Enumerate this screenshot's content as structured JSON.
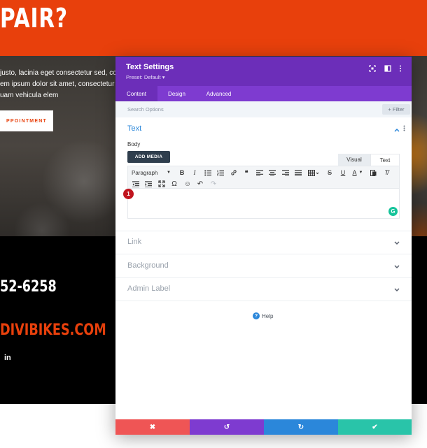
{
  "background_page": {
    "hero_title": "PAIR?",
    "hero_text_lines": [
      "justo, lacinia eget consectetur sed, conv",
      "em ipsum dolor sit amet, consectetur ad",
      "uam vehicula elem"
    ],
    "hero_button_label": "PPOINTMENT",
    "phone": "52-6258",
    "email": "DIVIBIKES.COM",
    "social_label": "in",
    "colors": {
      "brand": "#e8400c",
      "dark": "#000000"
    }
  },
  "modal": {
    "title": "Text Settings",
    "preset": "Preset: Default ▾",
    "header_icons": [
      "expand-icon",
      "sidebar-icon",
      "more-icon"
    ],
    "tabs": [
      {
        "label": "Content",
        "active": true
      },
      {
        "label": "Design",
        "active": false
      },
      {
        "label": "Advanced",
        "active": false
      }
    ],
    "search_placeholder": "Search Options",
    "filter_label": "+ Filter",
    "text_section": {
      "title": "Text",
      "body_label": "Body",
      "add_media_label": "ADD MEDIA",
      "mode_tabs": [
        "Visual",
        "Text"
      ],
      "paragraph_select": "Paragraph",
      "toolbar_glyphs": {
        "row1": [
          "B",
          "I",
          "☰",
          "≡",
          "🔗",
          "❝",
          "⫷",
          "≡",
          "⫸",
          "☰",
          "▦",
          "S",
          "U",
          "A",
          "⎘",
          "T̸"
        ],
        "row2": [
          "⇤",
          "⇥",
          "⤢",
          "Ω",
          "☺",
          "↶",
          "↷"
        ]
      },
      "badge_number": "1",
      "grammarly_label": "G"
    },
    "collapsed_sections": [
      "Link",
      "Background",
      "Admin Label"
    ],
    "help_label": "Help",
    "footer_buttons": [
      {
        "name": "discard",
        "glyph": "✖",
        "color": "#ef5555"
      },
      {
        "name": "undo",
        "glyph": "↺",
        "color": "#7e3bd0"
      },
      {
        "name": "redo",
        "glyph": "↻",
        "color": "#2b87da"
      },
      {
        "name": "save",
        "glyph": "✔",
        "color": "#29c4a9"
      }
    ],
    "colors": {
      "header": "#6c2eb9",
      "tabs": "#7e3bd0",
      "accent_blue": "#2b87da"
    }
  }
}
